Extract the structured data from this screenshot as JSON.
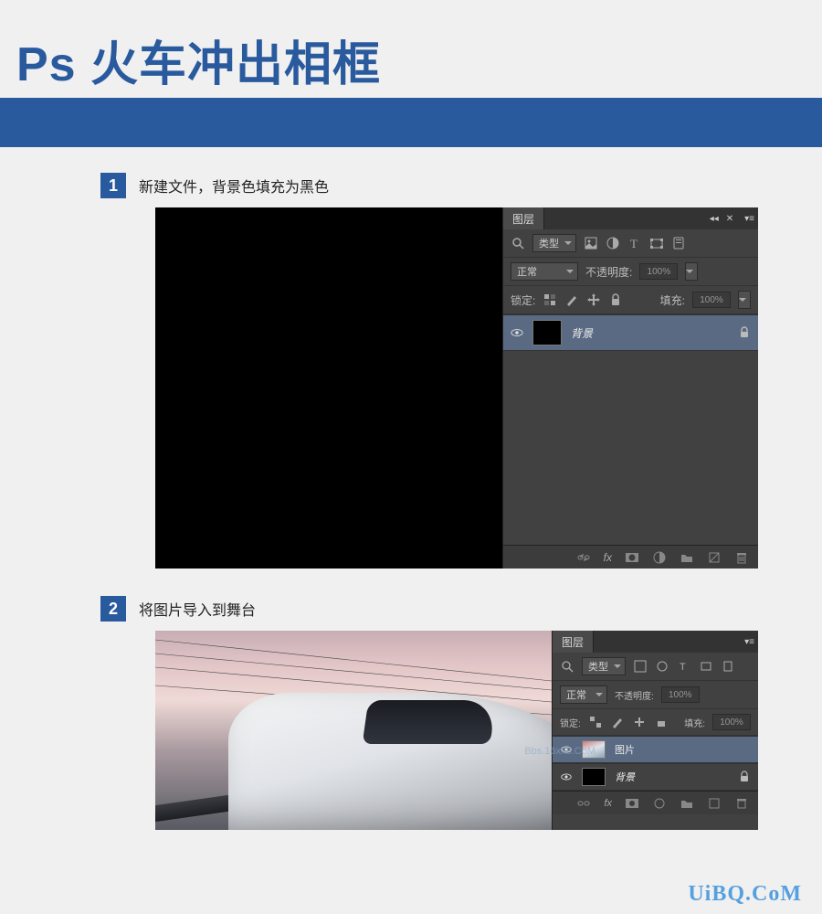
{
  "title": "Ps 火车冲出相框",
  "steps": [
    {
      "num": "1",
      "text": "新建文件，背景色填充为黑色"
    },
    {
      "num": "2",
      "text": "将图片导入到舞台"
    }
  ],
  "panel1": {
    "tab": "图层",
    "kind_label": "类型",
    "blend": "正常",
    "opacity_label": "不透明度:",
    "opacity_value": "100%",
    "lock_label": "锁定:",
    "fill_label": "填充:",
    "fill_value": "100%",
    "layer_bg": "背景"
  },
  "panel2": {
    "tab": "图层",
    "kind_label": "类型",
    "blend": "正常",
    "opacity_label": "不透明度:",
    "opacity_value": "100%",
    "lock_label": "锁定:",
    "fill_label": "填充:",
    "fill_value": "100%",
    "layer_img": "图片",
    "layer_bg": "背景"
  },
  "bottom_icons": {
    "fx": "fx"
  },
  "watermark": "UiBQ.CoM",
  "wm_small": "Bbs.16xx8.CoM"
}
